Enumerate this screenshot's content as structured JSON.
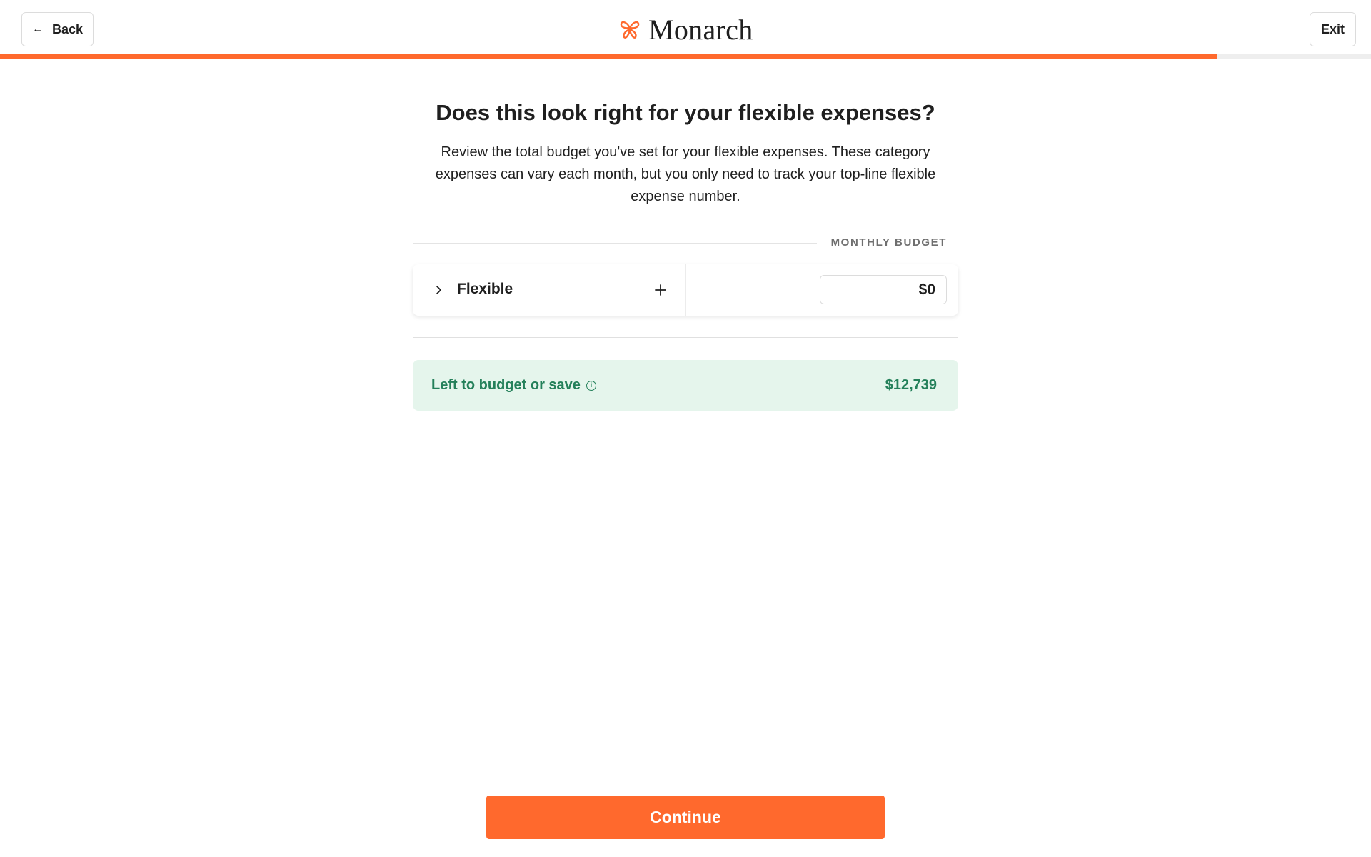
{
  "header": {
    "back_label": "Back",
    "back_icon": "arrow-left-icon",
    "exit_label": "Exit",
    "logo_text": "Monarch",
    "logo_icon": "butterfly-icon",
    "progress_fraction": 0.888
  },
  "main": {
    "title": "Does this look right for your flexible expenses?",
    "subtitle": "Review the total budget you've set for your flexible expenses. These category expenses can vary each month, but you only need to track your top-line flexible expense number.",
    "column_header": "MONTHLY BUDGET",
    "group": {
      "label": "Flexible",
      "amount": "$0",
      "expand_icon": "chevron-right-icon",
      "add_icon": "plus-icon"
    },
    "left_to_budget": {
      "label": "Left to budget or save",
      "value": "$12,739",
      "info_icon": "info-icon"
    }
  },
  "footer": {
    "continue_label": "Continue"
  },
  "colors": {
    "accent": "#ff692d",
    "success_text": "#24805a",
    "success_bg": "#e5f5ec"
  }
}
